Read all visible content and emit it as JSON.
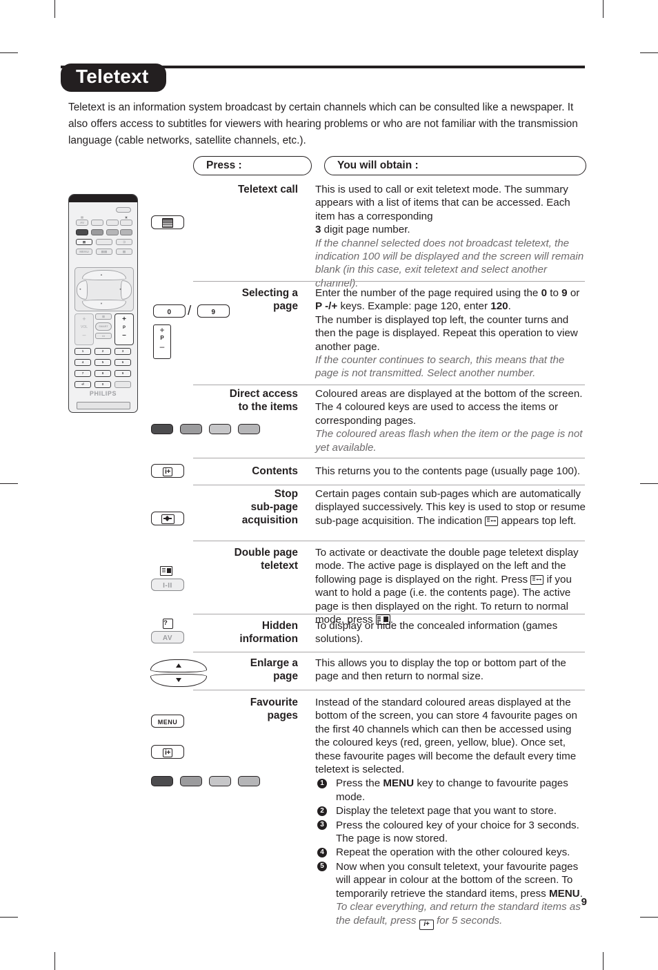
{
  "document": {
    "title": "Teletext",
    "page_number": "9",
    "intro": "Teletext is an information system broadcast by certain channels which can be consulted like a newspaper. It also offers access to subtitles for viewers with hearing problems or who are not familiar with the transmission language (cable networks, satellite channels, etc.)."
  },
  "columns": {
    "press": "Press :",
    "obtain": "You will obtain :"
  },
  "rows": {
    "teletext_call": {
      "label": "Teletext call",
      "body_main": "This is used to call or exit teletext mode. The summary appears with a list of items that can be accessed. Each item has a corresponding",
      "body_line2_bold": "3",
      "body_line2_rest": " digit page number.",
      "note": "If the channel selected does not broadcast teletext, the indication 100 will be displayed and the screen will remain blank (in this case, exit teletext and select another channel)."
    },
    "selecting_page": {
      "label_line1": "Selecting a",
      "label_line2": "page",
      "body_p1_a": "Enter the number of the page required using the ",
      "body_p1_b0": "0",
      "body_p1_c": " to ",
      "body_p1_b9": "9",
      "body_p1_d": " or ",
      "body_p1_bp": "P -/+",
      "body_p1_e": " keys. Example: page 120, enter ",
      "body_p1_b120": "120",
      "body_p1_f": ".",
      "body_p2": "The number is displayed top left, the counter turns and then the page is displayed. Repeat this operation to view another page.",
      "note": "If the counter continues to search, this means that the page is not transmitted. Select another number.",
      "key_0": "0",
      "key_9": "9",
      "separator": "/",
      "key_p_plus": "+",
      "key_p_label": "P",
      "key_p_minus": "–"
    },
    "direct_access": {
      "label_line1": "Direct access",
      "label_line2": "to the items",
      "body": "Coloured areas are displayed at the bottom of the screen. The 4 coloured keys are used to access the items or corresponding pages.",
      "note": "The coloured areas flash when the item or the page is not yet available."
    },
    "contents": {
      "label": "Contents",
      "body": "This returns you to the contents page (usually page 100)."
    },
    "stop_subpage": {
      "label_line1": "Stop",
      "label_line2": "sub-page",
      "label_line3": "acquisition",
      "body_a": "Certain pages contain sub-pages which are automatically displayed successively. This key is used to stop or resume sub-page acquisition. The indication ",
      "body_b": " appears top left."
    },
    "double_page": {
      "label_line1": "Double page",
      "label_line2": "teletext",
      "body_a": "To activate or deactivate the double page teletext display mode. The active page is displayed on the left and the following page is displayed on the right. Press ",
      "body_b": " if you want to hold a page (i.e. the contents page). The active page is then displayed on the right. To return to normal mode, press ",
      "body_c": ".",
      "key_label": "I-II"
    },
    "hidden_information": {
      "label_line1": "Hidden",
      "label_line2": "information",
      "body": "To display or hide the concealed information (games solutions).",
      "key_label": "AV",
      "key_glyph": "?"
    },
    "enlarge_page": {
      "label_line1": "Enlarge a",
      "label_line2": "page",
      "body": "This allows you to display the top or bottom part of the page and then return to normal size."
    },
    "favourite_pages": {
      "label_line1": "Favourite",
      "label_line2": "pages",
      "body": "Instead of the standard coloured areas displayed at the bottom of the screen, you can store 4 favourite pages on the first 40 channels which can then be accessed using the coloured keys (red, green, yellow, blue). Once set, these favourite pages will become the default every time teletext is selected.",
      "key_menu": "MENU",
      "steps": [
        {
          "num": "1",
          "a": "Press the ",
          "bold": "MENU",
          "b": " key to change to favourite pages mode."
        },
        {
          "num": "2",
          "a": "Display the teletext page that you want to store.",
          "bold": "",
          "b": ""
        },
        {
          "num": "3",
          "a": "Press the coloured key of your choice for 3 seconds. The page is now stored.",
          "bold": "",
          "b": ""
        },
        {
          "num": "4",
          "a": "Repeat the operation with the other coloured keys.",
          "bold": "",
          "b": ""
        },
        {
          "num": "5",
          "a": "Now when you consult teletext, your favourite pages will appear in colour at the bottom of the screen. To temporarily retrieve the standard items, press ",
          "bold": "MENU",
          "b": "."
        }
      ],
      "note_a": "To clear everything, and return the standard items as the default, press ",
      "note_b": " for 5 seconds."
    }
  },
  "coloured_keys": {
    "fills": [
      "#4c4c4e",
      "#9b9b9d",
      "#c6c6c8",
      "#b5b5b7"
    ],
    "names": [
      "red-key",
      "green-key",
      "yellow-key",
      "blue-key"
    ]
  },
  "remote": {
    "brand": "PHILIPS",
    "keys_row_numeric": [
      "1",
      "2",
      "3",
      "4",
      "5",
      "6",
      "7",
      "8",
      "9",
      "0"
    ],
    "vol_label": "VOL",
    "p_label": "P",
    "menu_label": "MENU",
    "av_label": "AV",
    "smart_label": "SMART"
  }
}
